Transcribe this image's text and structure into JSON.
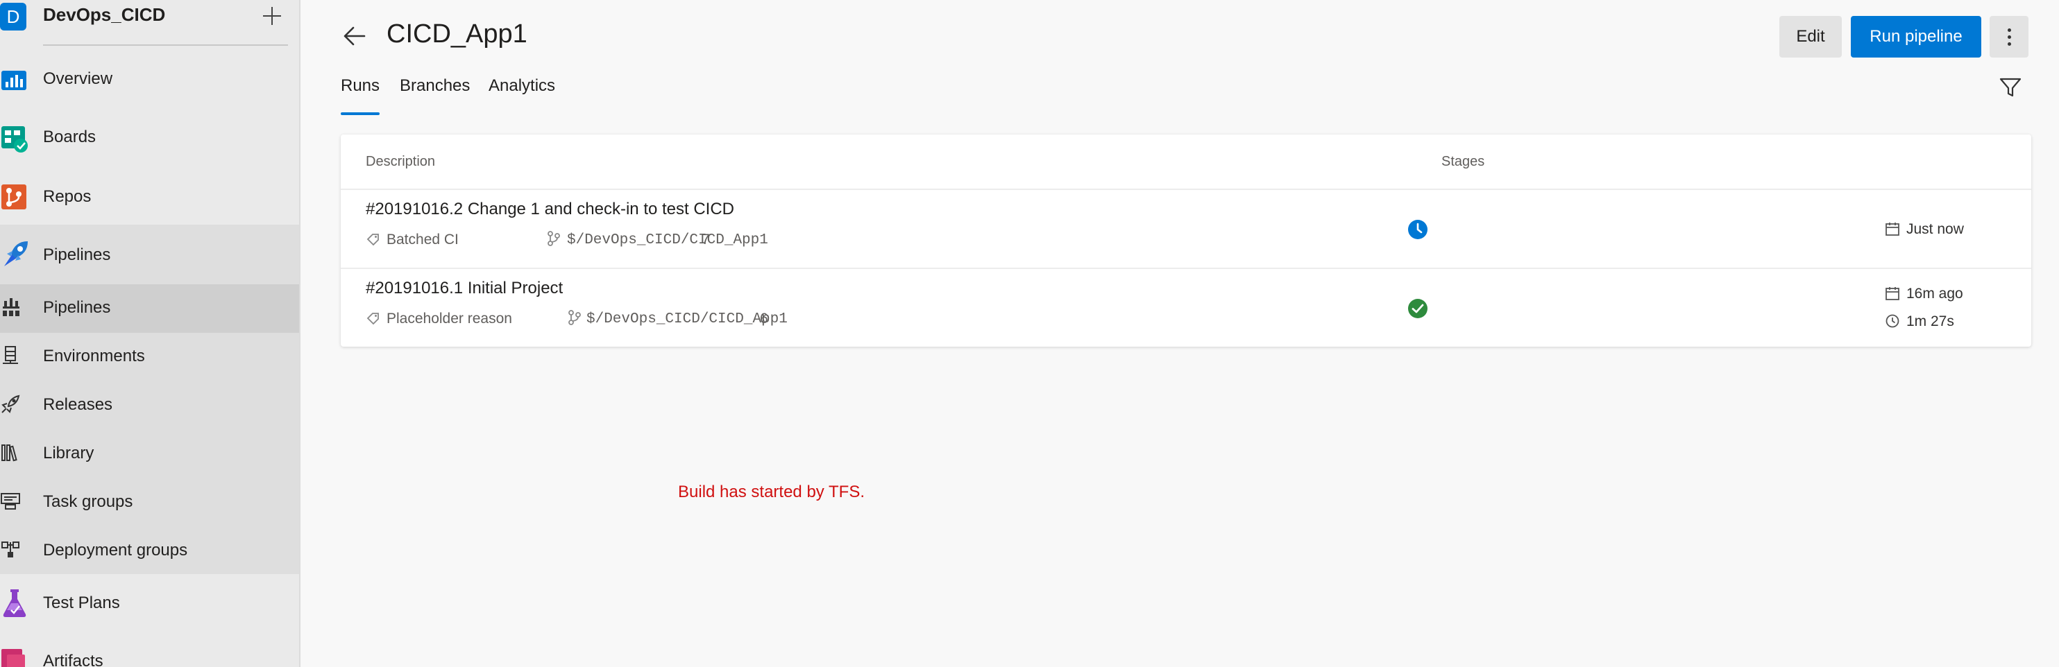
{
  "project": {
    "badge": "D",
    "name": "DevOps_CICD"
  },
  "nav": {
    "overview": "Overview",
    "boards": "Boards",
    "repos": "Repos",
    "pipelines_header": "Pipelines",
    "pipelines": "Pipelines",
    "environments": "Environments",
    "releases": "Releases",
    "library": "Library",
    "task_groups": "Task groups",
    "deployment_groups": "Deployment groups",
    "test_plans": "Test Plans",
    "artifacts": "Artifacts"
  },
  "header": {
    "title": "CICD_App1",
    "edit_label": "Edit",
    "run_label": "Run pipeline"
  },
  "tabs": {
    "runs": "Runs",
    "branches": "Branches",
    "analytics": "Analytics",
    "active": "Runs"
  },
  "table": {
    "col_description": "Description",
    "col_stages": "Stages",
    "rows": [
      {
        "title": "#20191016.2 Change 1 and check-in to test CICD",
        "reason": "Batched CI",
        "path": "$/DevOps_CICD/CICD_App1",
        "changeset": "7",
        "stage_status": "in-progress",
        "time": "Just now"
      },
      {
        "title": "#20191016.1 Initial Project",
        "reason": "Placeholder reason",
        "path": "$/DevOps_CICD/CICD_App1",
        "changeset": "6",
        "stage_status": "succeeded",
        "time": "16m ago",
        "duration": "1m 27s"
      }
    ]
  },
  "status_message": "Build has started by TFS.",
  "colors": {
    "accent": "#0078d4",
    "success": "#2e8b3d",
    "error": "#d01010"
  }
}
